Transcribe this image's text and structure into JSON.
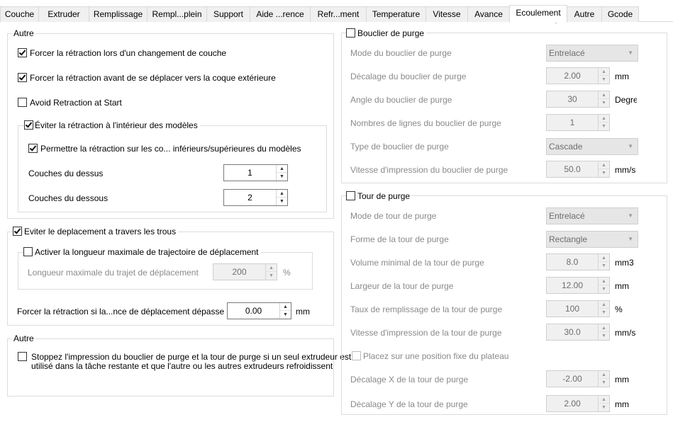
{
  "tabs": [
    {
      "label": "Couche"
    },
    {
      "label": "Extruder"
    },
    {
      "label": "Remplissage"
    },
    {
      "label": "Rempl...plein"
    },
    {
      "label": "Support"
    },
    {
      "label": "Aide ...rence"
    },
    {
      "label": "Refr...ment"
    },
    {
      "label": "Temperature"
    },
    {
      "label": "Vitesse"
    },
    {
      "label": "Avance"
    },
    {
      "label": "Ecoulement"
    },
    {
      "label": "Autre"
    },
    {
      "label": "Gcode"
    }
  ],
  "active_tab": "Ecoulement",
  "left": {
    "autre": {
      "title": "Autre",
      "force_retract_layer_change": {
        "label": "Forcer la rétraction lors d'un changement de couche",
        "checked": true
      },
      "force_retract_outer_shell": {
        "label": "Forcer la rétraction avant de se déplacer vers la coque extérieure",
        "checked": true
      },
      "avoid_retraction_start": {
        "label": "Avoid Retraction at Start",
        "checked": false
      },
      "avoid_retract_inside_models": {
        "label": "Éviter la rétraction à l'intérieur des modèles",
        "checked": true,
        "allow_retract_top_bottom": {
          "label": "Permettre la rétraction sur les co... inférieurs/supérieures du modèles",
          "checked": true
        },
        "top_layers": {
          "label": "Couches du dessus",
          "value": "1"
        },
        "bottom_layers": {
          "label": "Couches du dessous",
          "value": "2"
        }
      }
    },
    "avoid_holes": {
      "label": "Eviter le deplacement a travers les trous",
      "checked": true,
      "max_travel": {
        "label": "Activer la longueur maximale de trajectoire de déplacement",
        "checked": false,
        "length_label": "Longueur maximale du trajet de déplacement",
        "length_value": "200",
        "length_unit": "%"
      },
      "force_retract_distance": {
        "label": "Forcer la rétraction si la...nce de déplacement dépasse",
        "value": "0.00",
        "unit": "mm"
      }
    },
    "autre2": {
      "title": "Autre",
      "stop_purge": {
        "label_line1": "Stoppez l'impression du bouclier de purge et la tour de purge si un seul extrudeur est",
        "label_line2": "utilisé dans la tâche restante et que l'autre ou les autres extrudeurs refroidissent",
        "checked": false
      }
    }
  },
  "right": {
    "shield": {
      "title": "Bouclier de purge",
      "checked": false,
      "mode": {
        "label": "Mode du bouclier de purge",
        "value": "Entrelacé"
      },
      "offset": {
        "label": "Décalage du bouclier de purge",
        "value": "2.00",
        "unit": "mm"
      },
      "angle": {
        "label": "Angle du bouclier de purge",
        "value": "30",
        "unit": "Degres"
      },
      "lines": {
        "label": "Nombres de lignes du bouclier de purge",
        "value": "1"
      },
      "type": {
        "label": "Type de bouclier de purge",
        "value": "Cascade"
      },
      "speed": {
        "label": "Vitesse d'impression du bouclier de purge",
        "value": "50.0",
        "unit": "mm/s"
      }
    },
    "tower": {
      "title": "Tour de purge",
      "checked": false,
      "mode": {
        "label": "Mode de tour de purge",
        "value": "Entrelacé"
      },
      "shape": {
        "label": "Forme de la tour de purge",
        "value": "Rectangle"
      },
      "min_volume": {
        "label": "Volume minimal de la tour de purge",
        "value": "8.0",
        "unit": "mm3"
      },
      "width": {
        "label": "Largeur de la tour de purge",
        "value": "12.00",
        "unit": "mm"
      },
      "fill": {
        "label": "Taux de remplissage de la tour de purge",
        "value": "100",
        "unit": "%"
      },
      "speed": {
        "label": "Vitesse d'impression de la tour de purge",
        "value": "30.0",
        "unit": "mm/s"
      },
      "fixed_position": {
        "label": "Placez sur une position fixe du plateau",
        "checked": false
      },
      "offset_x": {
        "label": "Décalage X de la tour de purge",
        "value": "-2.00",
        "unit": "mm"
      },
      "offset_y": {
        "label": "Décalage Y de la tour de purge",
        "value": "2.00",
        "unit": "mm"
      }
    }
  },
  "spin_up": "▲",
  "spin_down": "▼",
  "combo_caret": "▼"
}
